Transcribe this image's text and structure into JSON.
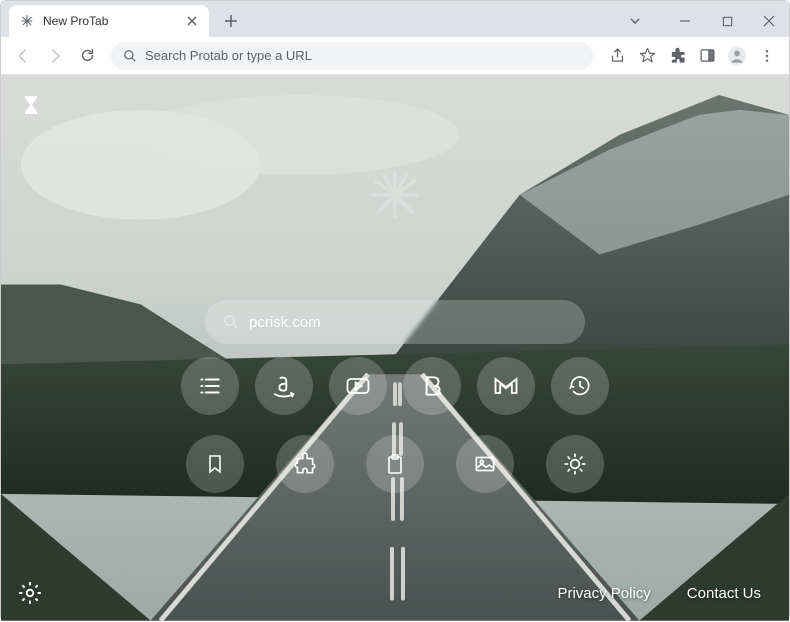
{
  "window": {
    "tab_title": "New ProTab"
  },
  "toolbar": {
    "url_placeholder": "Search Protab or type a URL"
  },
  "page": {
    "search_value": "pcrisk.com",
    "shortcuts_row1": [
      {
        "name": "list-icon"
      },
      {
        "name": "amazon-icon"
      },
      {
        "name": "youtube-icon"
      },
      {
        "name": "booking-icon"
      },
      {
        "name": "gmail-icon"
      },
      {
        "name": "history-icon"
      }
    ],
    "shortcuts_row2": [
      {
        "name": "bookmark-icon"
      },
      {
        "name": "extension-icon"
      },
      {
        "name": "clipboard-icon"
      },
      {
        "name": "image-icon"
      },
      {
        "name": "brightness-icon"
      }
    ],
    "footer": {
      "privacy": "Privacy Policy",
      "contact": "Contact Us"
    }
  }
}
